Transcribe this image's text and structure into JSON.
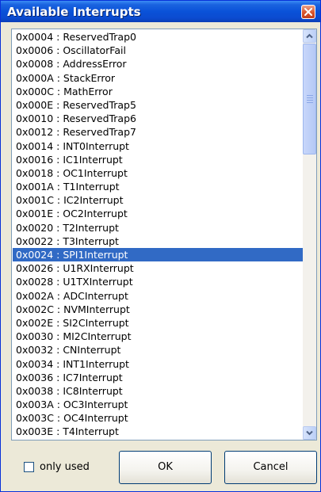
{
  "window": {
    "title": "Available Interrupts"
  },
  "list": {
    "selected_index": 16,
    "items": [
      "0x0004 : ReservedTrap0",
      "0x0006 : OscillatorFail",
      "0x0008 : AddressError",
      "0x000A : StackError",
      "0x000C : MathError",
      "0x000E : ReservedTrap5",
      "0x0010 : ReservedTrap6",
      "0x0012 : ReservedTrap7",
      "0x0014 : INT0Interrupt",
      "0x0016 : IC1Interrupt",
      "0x0018 : OC1Interrupt",
      "0x001A : T1Interrupt",
      "0x001C : IC2Interrupt",
      "0x001E : OC2Interrupt",
      "0x0020 : T2Interrupt",
      "0x0022 : T3Interrupt",
      "0x0024 : SPI1Interrupt",
      "0x0026 : U1RXInterrupt",
      "0x0028 : U1TXInterrupt",
      "0x002A : ADCInterrupt",
      "0x002C : NVMInterrupt",
      "0x002E : SI2CInterrupt",
      "0x0030 : MI2CInterrupt",
      "0x0032 : CNInterrupt",
      "0x0034 : INT1Interrupt",
      "0x0036 : IC7Interrupt",
      "0x0038 : IC8Interrupt",
      "0x003A : OC3Interrupt",
      "0x003C : OC4Interrupt",
      "0x003E : T4Interrupt"
    ]
  },
  "footer": {
    "only_used_label": "only used",
    "only_used_checked": false,
    "ok_label": "OK",
    "cancel_label": "Cancel"
  },
  "icons": {
    "close": "close-icon",
    "scroll_up": "chevron-up-icon",
    "scroll_down": "chevron-down-icon"
  },
  "colors": {
    "title_bar": "#0a52d8",
    "selection": "#316ac5",
    "dialog_bg": "#ece9d8",
    "close_button": "#d9542b"
  }
}
